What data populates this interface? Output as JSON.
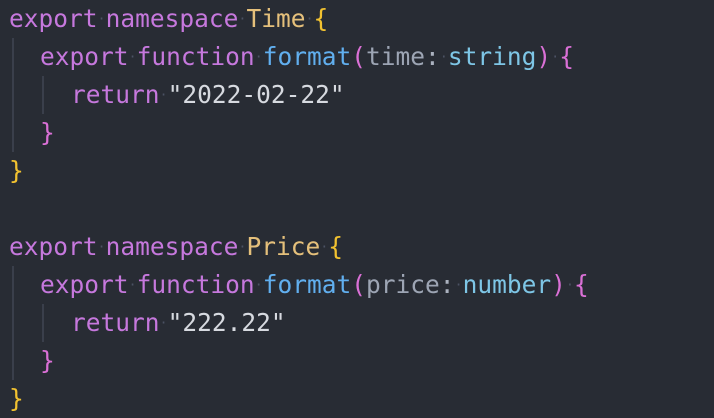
{
  "code": {
    "block1": {
      "kw_export": "export",
      "kw_namespace": "namespace",
      "name": "Time",
      "open_brace": "{",
      "fn_export": "export",
      "fn_keyword": "function",
      "fn_name": "format",
      "open_paren": "(",
      "param_name": "time",
      "param_colon": ":",
      "param_type": "string",
      "close_paren": ")",
      "fn_open_brace": "{",
      "kw_return": "return",
      "return_value": "\"2022-02-22\"",
      "fn_close_brace": "}",
      "close_brace": "}"
    },
    "block2": {
      "kw_export": "export",
      "kw_namespace": "namespace",
      "name": "Price",
      "open_brace": "{",
      "fn_export": "export",
      "fn_keyword": "function",
      "fn_name": "format",
      "open_paren": "(",
      "param_name": "price",
      "param_colon": ":",
      "param_type": "number",
      "close_paren": ")",
      "fn_open_brace": "{",
      "kw_return": "return",
      "return_value": "\"222.22\"",
      "fn_close_brace": "}",
      "close_brace": "}"
    }
  },
  "colors": {
    "background": "#282c34",
    "keyword": "#c678dd",
    "namespace_name": "#e5c07b",
    "function_name": "#61afef",
    "parameter": "#9da5b4",
    "type": "#7ec6e6",
    "string": "#d7dae0",
    "brace_outer": "#f2c230",
    "brace_inner": "#da70d6"
  }
}
